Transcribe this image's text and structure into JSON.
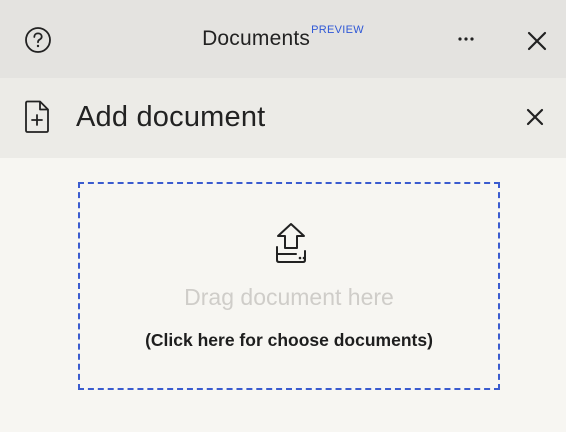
{
  "topbar": {
    "help_icon": "question-circle-icon",
    "title": "Documents",
    "badge": "PREVIEW",
    "more_icon": "ellipsis-horizontal-icon",
    "close_icon": "close-icon"
  },
  "panel": {
    "icon": "document-add-icon",
    "title": "Add document",
    "close_icon": "close-icon"
  },
  "dropzone": {
    "icon": "upload-tray-icon",
    "drag_text": "Drag document here",
    "choose_text": "(Click here for choose documents)"
  },
  "colors": {
    "topbar_bg": "#e4e3e0",
    "panel_header_bg": "#ecebe7",
    "body_bg": "#f7f6f2",
    "accent_blue": "#2f58d6",
    "muted_text": "#cfcdc9"
  }
}
